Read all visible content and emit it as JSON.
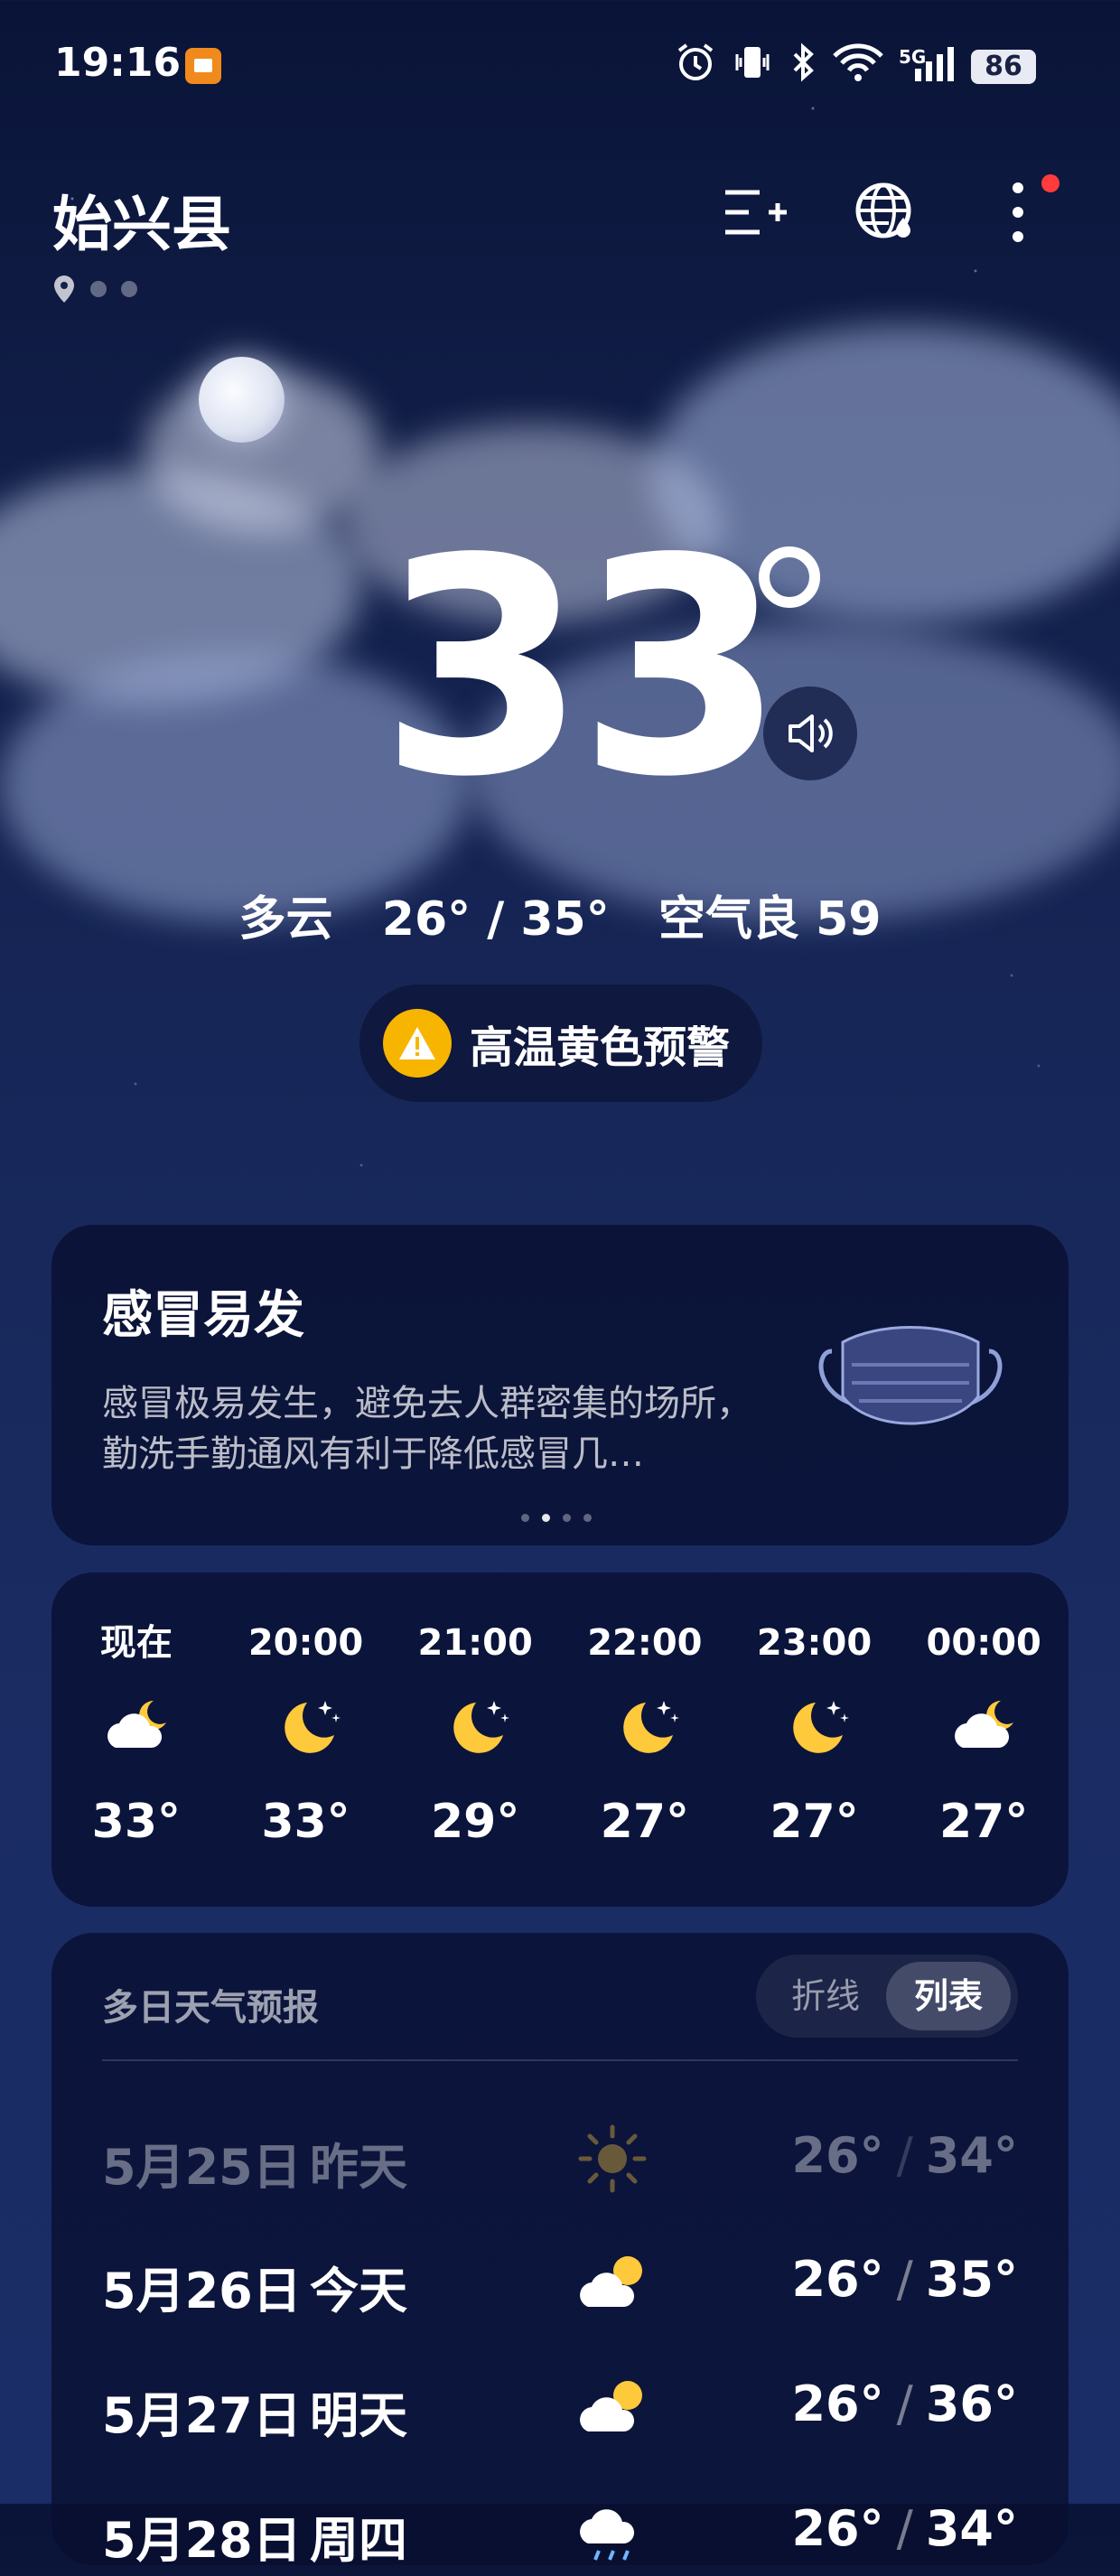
{
  "status": {
    "time": "19:16",
    "net": "5G",
    "battery": "86"
  },
  "header": {
    "city": "始兴县"
  },
  "current": {
    "temperature": "33",
    "condition": "多云",
    "range": "26° / 35°",
    "air": "空气良 59",
    "summary": "多云  26° / 35°  空气良 59"
  },
  "alert": {
    "text": "高温黄色预警"
  },
  "tip": {
    "title": "感冒易发",
    "desc": "感冒极易发生，避免去人群密集的场所，勤洗手勤通风有利于降低感冒几…"
  },
  "hourly": [
    {
      "label": "现在",
      "icon": "cloudy-night-icon",
      "temp": "33°"
    },
    {
      "label": "20:00",
      "icon": "moon-icon",
      "temp": "33°"
    },
    {
      "label": "21:00",
      "icon": "moon-icon",
      "temp": "29°"
    },
    {
      "label": "22:00",
      "icon": "moon-icon",
      "temp": "27°"
    },
    {
      "label": "23:00",
      "icon": "moon-icon",
      "temp": "27°"
    },
    {
      "label": "00:00",
      "icon": "cloudy-night-icon",
      "temp": "27°"
    }
  ],
  "forecast": {
    "title": "多日天气预报",
    "toggle_line": "折线",
    "toggle_list": "列表",
    "rows": [
      {
        "date": "5月25日",
        "day": "昨天",
        "icon": "sun-icon",
        "low": "26°",
        "high": "34°"
      },
      {
        "date": "5月26日",
        "day": "今天",
        "icon": "partly-cloudy-icon",
        "low": "26°",
        "high": "35°"
      },
      {
        "date": "5月27日",
        "day": "明天",
        "icon": "partly-cloudy-icon",
        "low": "26°",
        "high": "36°"
      },
      {
        "date": "5月28日",
        "day": "周四",
        "icon": "rain-cloud-icon",
        "low": "26°",
        "high": "34°"
      }
    ]
  },
  "colors": {
    "accent_yellow": "#f7b500",
    "moon_yellow": "#ffc93c",
    "alert_dot": "#ff3b3b"
  }
}
